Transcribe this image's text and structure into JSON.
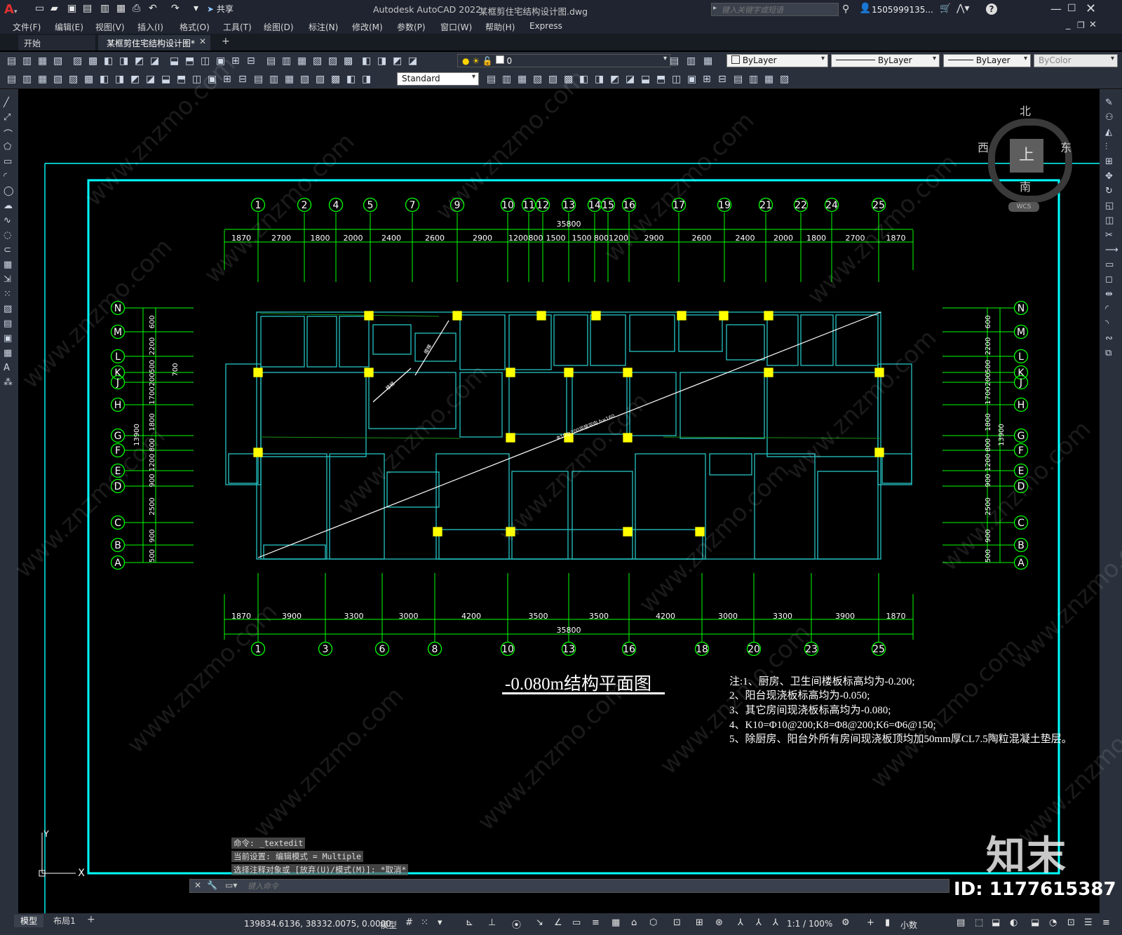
{
  "app": {
    "title": "Autodesk AutoCAD 2022",
    "file": "某框剪住宅结构设计图.dwg",
    "share_label": "共享",
    "search_placeholder": "键入关键字或短语",
    "user": "1505999135...",
    "logo_letter": "A"
  },
  "menu": [
    "文件(F)",
    "编辑(E)",
    "视图(V)",
    "插入(I)",
    "格式(O)",
    "工具(T)",
    "绘图(D)",
    "标注(N)",
    "修改(M)",
    "参数(P)",
    "窗口(W)",
    "帮助(H)",
    "Express"
  ],
  "tabs": [
    {
      "label": "开始",
      "active": false
    },
    {
      "label": "某框剪住宅结构设计图*",
      "active": true
    }
  ],
  "toolbar": {
    "layer_value": "0",
    "color_value": "ByLayer",
    "linetype_value": "ByLayer",
    "lineweight_value": "ByLayer",
    "plotstyle_value": "ByColor",
    "textstyle_value": "Standard"
  },
  "viewcube": {
    "north": "北",
    "south": "南",
    "east": "东",
    "west": "西",
    "top": "上",
    "wcs": "WCS"
  },
  "drawing": {
    "title": "-0.080m结构平面图",
    "top_axes": [
      "1",
      "2",
      "4",
      "5",
      "7",
      "9",
      "10",
      "11",
      "12",
      "13",
      "14",
      "15",
      "16",
      "17",
      "19",
      "21",
      "22",
      "24",
      "25"
    ],
    "top_dims": [
      "1870",
      "2700",
      "1800",
      "2000",
      "2400",
      "2600",
      "2900",
      "1200",
      "800",
      "1500",
      "1500",
      "800",
      "1200",
      "2900",
      "2600",
      "2400",
      "2000",
      "1800",
      "2700",
      "1870"
    ],
    "top_total": "35800",
    "bottom_axes": [
      "1",
      "3",
      "6",
      "8",
      "10",
      "13",
      "16",
      "18",
      "20",
      "23",
      "25"
    ],
    "bottom_dims": [
      "1870",
      "3900",
      "3300",
      "3000",
      "4200",
      "3500",
      "3500",
      "4200",
      "3000",
      "3300",
      "3900",
      "1870"
    ],
    "bottom_total": "35800",
    "row_axes": [
      "N",
      "M",
      "L",
      "K",
      "J",
      "H",
      "G",
      "F",
      "E",
      "D",
      "C",
      "B",
      "A"
    ],
    "left_dims": [
      "600",
      "2200",
      "500",
      "200",
      "1700",
      "1800",
      "800",
      "1200",
      "900",
      "2500",
      "900",
      "500"
    ],
    "left_total": "13900",
    "left_extra": "700",
    "slab_note": "Φ10@200双层双向 h=160",
    "stair_label_1": "楼梯",
    "stair_label_2": "楼梯",
    "notes": [
      "注:1、厨房、卫生间楼板标高均为-0.200;",
      "2、阳台现浇板标高均为-0.050;",
      "3、其它房间现浇板标高均为-0.080;",
      "4、K10=Φ10@200;K8=Φ8@200;K6=Φ6@150;",
      "5、除厨房、阳台外所有房间现浇板顶均加50mm厚CL7.5陶粒混凝土垫层。"
    ],
    "ucs_x": "X",
    "ucs_y": "Y"
  },
  "command": {
    "history": [
      "命令: _textedit",
      "当前设置: 编辑模式 = Multiple",
      "选择注释对象或 [放弃(U)/模式(M)]: *取消*"
    ],
    "placeholder": "键入命令"
  },
  "status": {
    "model_tab": "模型",
    "layout_tab": "布局1",
    "coords": "139834.6136, 38332.0075, 0.0000",
    "model_label": "模型",
    "scale": "1:1 / 100%",
    "units": "小数"
  },
  "watermark": {
    "brand": "知末",
    "id": "ID: 1177615387",
    "text": "www.znzmo.com"
  },
  "colors": {
    "wall": "#25c4c4",
    "axis": "#00ff00",
    "column": "#ffff00",
    "frame": "#00ffff",
    "text": "#ffffff",
    "bg": "#000000",
    "ui": "#2b313c"
  }
}
